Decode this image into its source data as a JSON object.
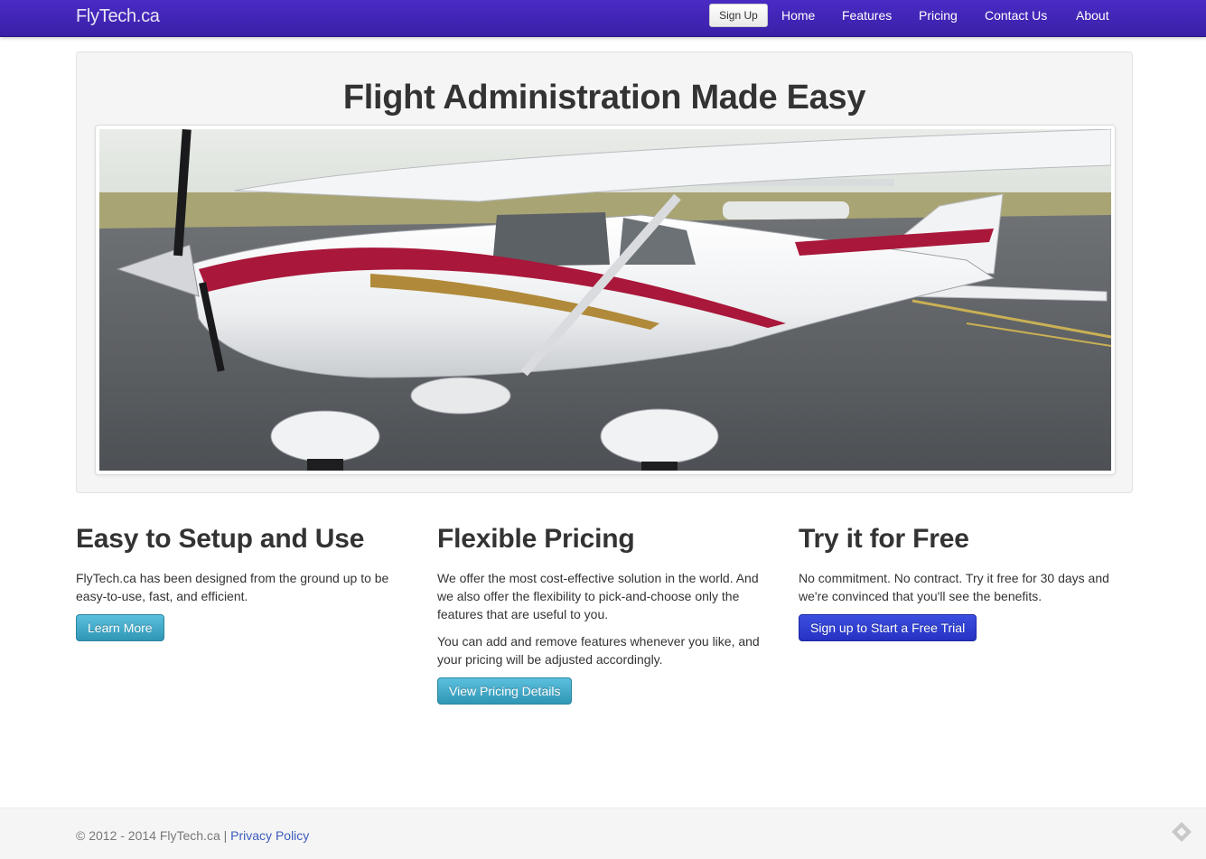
{
  "brand": "FlyTech.ca",
  "nav": {
    "signup_label": "Sign Up",
    "links": [
      "Home",
      "Features",
      "Pricing",
      "Contact Us",
      "About"
    ]
  },
  "hero": {
    "title": "Flight Administration Made Easy",
    "image_alt": "airplane-photo"
  },
  "features": [
    {
      "title": "Easy to Setup and Use",
      "paragraphs": [
        "FlyTech.ca has been designed from the ground up to be easy-to-use, fast, and efficient."
      ],
      "button": "Learn More"
    },
    {
      "title": "Flexible Pricing",
      "paragraphs": [
        "We offer the most cost-effective solution in the world. And we also offer the flexibility to pick-and-choose only the features that are useful to you.",
        "You can add and remove features whenever you like, and your pricing will be adjusted accordingly."
      ],
      "button": "View Pricing Details"
    },
    {
      "title": "Try it for Free",
      "paragraphs": [
        "No commitment. No contract. Try it free for 30 days and we're convinced that you'll see the benefits."
      ],
      "button": "Sign up to Start a Free Trial"
    }
  ],
  "footer": {
    "copyright": "© 2012 - 2014 FlyTech.ca |",
    "privacy_link": "Privacy Policy",
    "icon": "feedly-icon"
  },
  "colors": {
    "navbar": "#3a1fa8",
    "info_button": "#2f96b4",
    "primary_button": "#2631c2",
    "link": "#3b5bbd"
  }
}
